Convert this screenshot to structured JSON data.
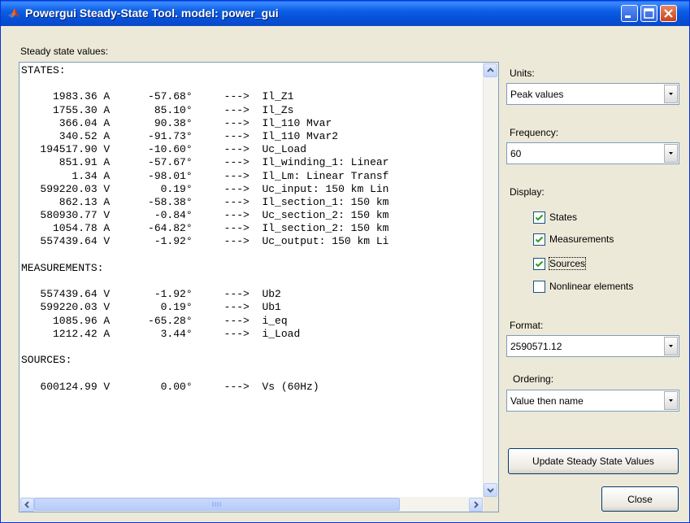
{
  "window": {
    "title": "Powergui Steady-State Tool. model: power_gui"
  },
  "labels": {
    "steady_state_values": "Steady state values:",
    "units": "Units:",
    "frequency": "Frequency:",
    "display": "Display:",
    "format": "Format:",
    "ordering": "Ordering:"
  },
  "units_value": "Peak values",
  "frequency_value": "60",
  "format_value": "2590571.12",
  "ordering_value": "Value then name",
  "display_options": [
    {
      "label": "States",
      "checked": true
    },
    {
      "label": "Measurements",
      "checked": true
    },
    {
      "label": "Sources",
      "checked": true
    },
    {
      "label": "Nonlinear elements",
      "checked": false
    }
  ],
  "buttons": {
    "update": "Update Steady State Values",
    "close": "Close"
  },
  "output_lines": [
    "STATES:",
    "",
    "     1983.36 A      -57.68°     --->  Il_Z1",
    "     1755.30 A       85.10°     --->  Il_Zs",
    "      366.04 A       90.38°     --->  Il_110 Mvar",
    "      340.52 A      -91.73°     --->  Il_110 Mvar2",
    "   194517.90 V      -10.60°     --->  Uc_Load",
    "      851.91 A      -57.67°     --->  Il_winding_1: Linear",
    "        1.34 A      -98.01°     --->  Il_Lm: Linear Transf",
    "   599220.03 V        0.19°     --->  Uc_input: 150 km Lin",
    "      862.13 A      -58.38°     --->  Il_section_1: 150 km",
    "   580930.77 V       -0.84°     --->  Uc_section_2: 150 km",
    "     1054.78 A      -64.82°     --->  Il_section_2: 150 km",
    "   557439.64 V       -1.92°     --->  Uc_output: 150 km Li",
    "",
    "MEASUREMENTS:",
    "",
    "   557439.64 V       -1.92°     --->  Ub2",
    "   599220.03 V        0.19°     --->  Ub1",
    "     1085.96 A      -65.28°     --->  i_eq",
    "     1212.42 A        3.44°     --->  i_Load",
    "",
    "SOURCES:",
    "",
    "   600124.99 V        0.00°     --->  Vs (60Hz)"
  ]
}
